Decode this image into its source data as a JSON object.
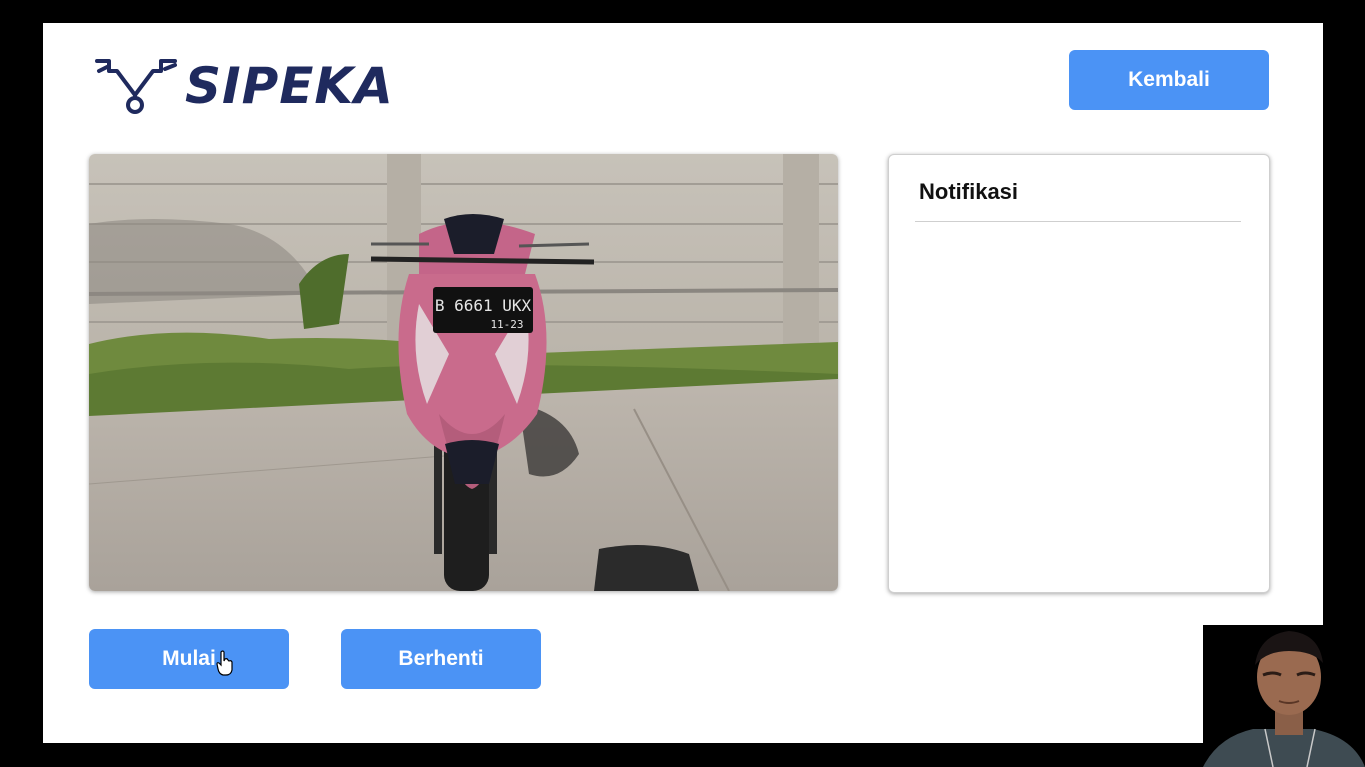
{
  "app": {
    "logo_text": "SIPEKA",
    "logo_icon": "motorcycle-handlebar-icon"
  },
  "header": {
    "back_label": "Kembali"
  },
  "camera": {
    "plate_line1": "B 6661 UKX",
    "plate_line2": "11-23"
  },
  "notifications": {
    "title": "Notifikasi",
    "items": []
  },
  "controls": {
    "start_label": "Mulai",
    "stop_label": "Berhenti"
  },
  "colors": {
    "primary": "#4b93f5",
    "brand": "#1f2a5e",
    "background": "#ffffff"
  }
}
